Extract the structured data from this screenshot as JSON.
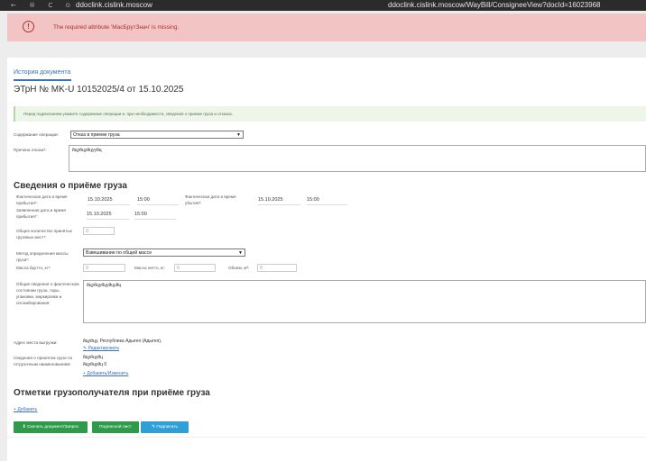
{
  "browser": {
    "nav_icons": "← ® C ⊙",
    "host": "ddoclink.cislink.moscow",
    "url": "ddoclink.cislink.moscow/WayBill/ConsigneeView?docId=16023968"
  },
  "alert": {
    "icon": "!",
    "message": "The required attribute 'МасБрутЗнач' is missing."
  },
  "tab": "История документа",
  "doc_title": "ЭТрН №   MK-U 10152025/4  от   15.10.2025",
  "info_note": "Перед подписанием укажите содержание операции и, при необходимости, сведения о приеме груза и отказах.",
  "operation": {
    "label": "Содержание операции:",
    "selected": "Отказ в приеме груза"
  },
  "reason": {
    "label": "Причина отказа*:",
    "value": "йцуйцуйцууйц"
  },
  "section_title": "Сведения о приёме груза",
  "actual_arrival": {
    "label": "Фактическая дата и время прибытия*:",
    "date": "15.10.2025",
    "time": "15:00"
  },
  "actual_departure": {
    "label": "Фактическая дата и время убытия*:",
    "date": "15.10.2025",
    "time": "15:00"
  },
  "planned_arrival": {
    "label": "Заявленная дата и время прибытия*:",
    "date": "15.10.2025",
    "time": "15:00"
  },
  "places": {
    "label": "Общее количество принятых грузовых мест*:",
    "placeholder": "0"
  },
  "method": {
    "label": "Метод определения массы груза*:",
    "selected": "Взвешивание по общей массе"
  },
  "gross": {
    "label": "Масса брутто, кг*:",
    "placeholder": "0"
  },
  "net": {
    "label": "Масса нетто, кг:",
    "placeholder": "0"
  },
  "volume": {
    "label": "Объём, м³:",
    "placeholder": "0"
  },
  "condition": {
    "label": "Общие сведения о фактическом состоянии груза, тары, упаковки, маркировки и опломбирования:",
    "value": "йцуйцуйцуйцуйц"
  },
  "unload_address": {
    "label": "Адрес места выгрузки:",
    "value": "йцуйцу, Республика Адыгея (Адыгея),",
    "edit_link": "Редактировать"
  },
  "accepted_cargo": {
    "label": "Сведения о принятом грузе по отгрузочным наименованиям:",
    "line1": "йцуйцуйц",
    "line2": "йцуйцуйц 0",
    "add_link": "Добавить/Изменить"
  },
  "marks_title": "Отметки грузополучателя при приёме груза",
  "add_mark_link": "Добавить",
  "buttons": {
    "download": "Скачать документ/Запрос",
    "sign_list": "Подписной лист",
    "sign": "Подписать"
  },
  "colors": {
    "green_button": "#2e9a4a",
    "blue_button": "#2f9fd6",
    "alert_bg": "#f2c4c4",
    "link": "#3a72b8"
  }
}
